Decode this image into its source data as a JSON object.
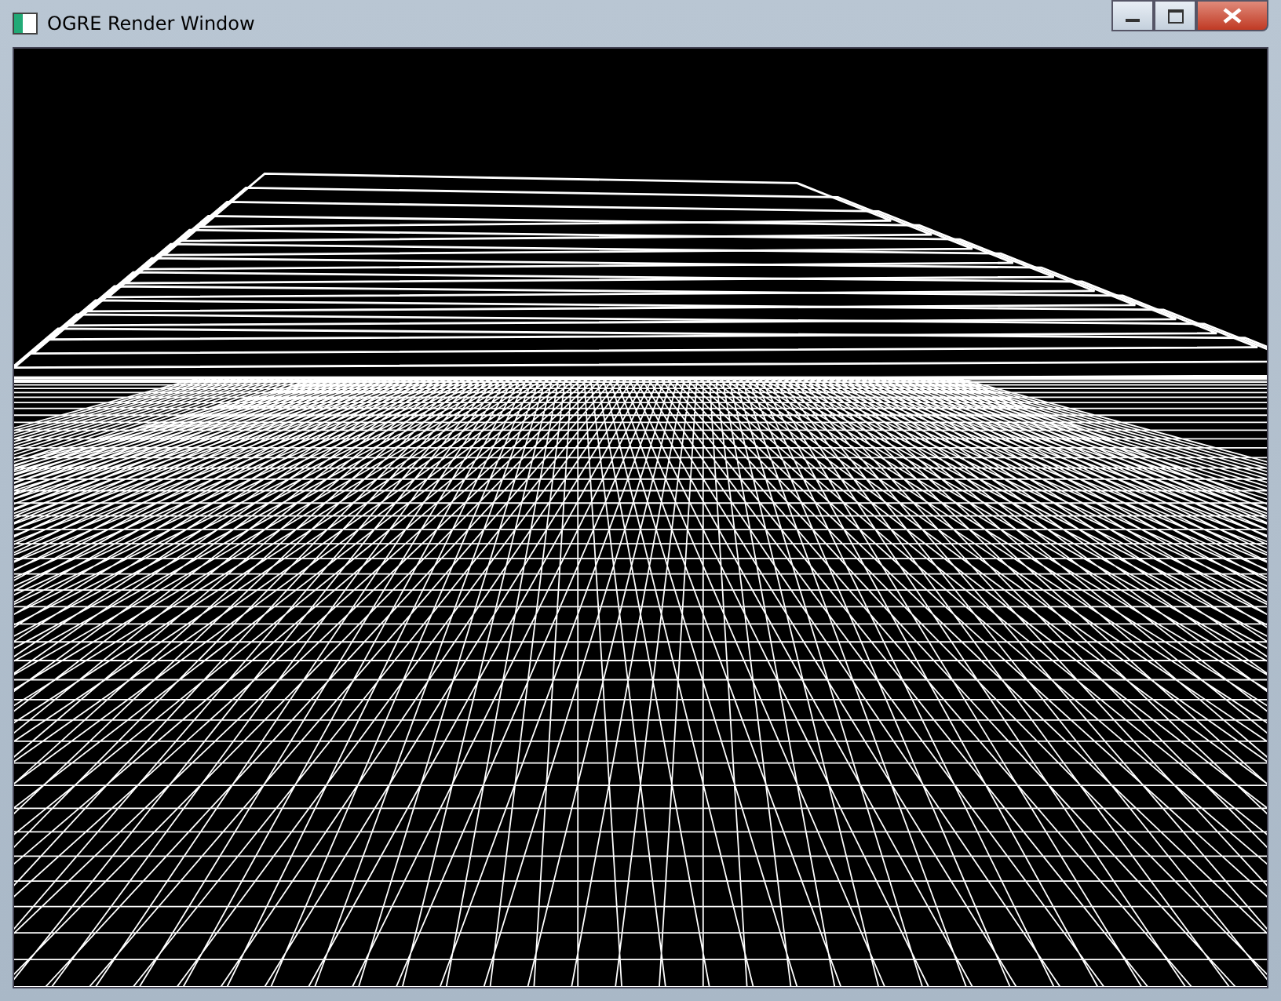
{
  "window": {
    "title": "OGRE Render Window"
  }
}
